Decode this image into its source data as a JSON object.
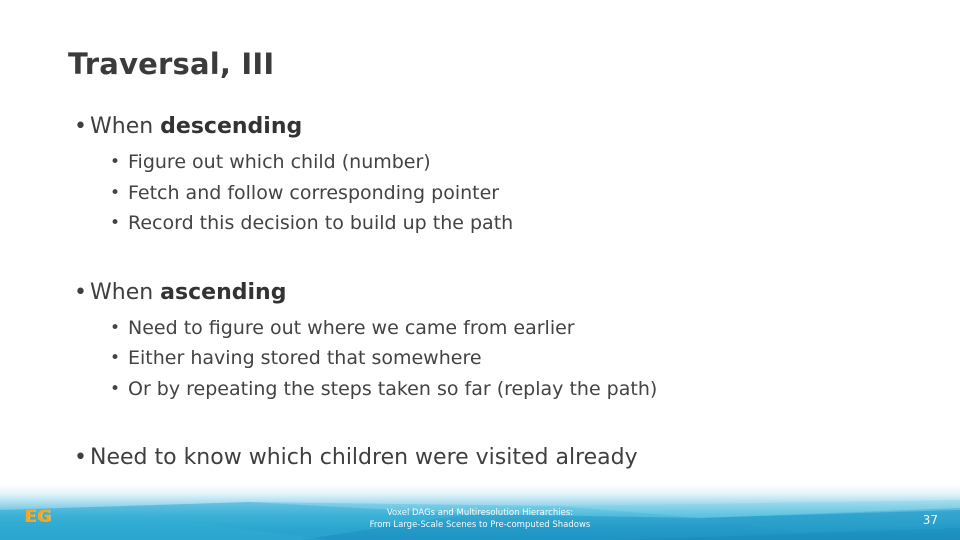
{
  "slide": {
    "title": "Traversal, III",
    "page_number": "37",
    "colors": {
      "title": "#3b3b3b",
      "body_text": "#3f3f3f",
      "band_light": "#a9dcef",
      "band_teal": "#29a3cf",
      "logo_gold": "#f0a828"
    }
  },
  "content": {
    "blocks": [
      {
        "lead_prefix": "When ",
        "lead_emphasis": "descending",
        "sub_bullets": [
          "Figure out which child (number)",
          "Fetch and follow corresponding pointer",
          "Record this decision to build up the path"
        ]
      },
      {
        "lead_prefix": "When ",
        "lead_emphasis": "ascending",
        "sub_bullets": [
          "Need to figure out where we came from earlier",
          "Either having stored that somewhere",
          "Or by repeating the steps taken so far (replay the path)"
        ]
      }
    ],
    "closing_bullet": "Need to know which children were visited already",
    "bullet_glyph_level1": "•",
    "bullet_glyph_level2": "•"
  },
  "footer": {
    "caption_line1": "Voxel DAGs and Multiresolution Hierarchies:",
    "caption_line2": "From Large-Scale Scenes to Pre-computed Shadows",
    "logo_text_left": "E",
    "logo_text_right": "G"
  }
}
